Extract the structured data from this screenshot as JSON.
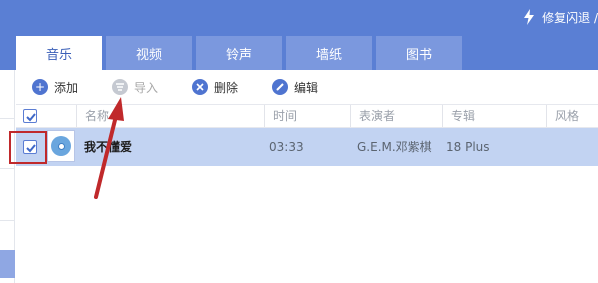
{
  "header": {
    "repair_label": "修复闪退 /"
  },
  "tabs": [
    {
      "label": "音乐",
      "active": true
    },
    {
      "label": "视频",
      "active": false
    },
    {
      "label": "铃声",
      "active": false
    },
    {
      "label": "墙纸",
      "active": false
    },
    {
      "label": "图书",
      "active": false
    }
  ],
  "toolbar": {
    "add_label": "添加",
    "import_label": "导入",
    "delete_label": "删除",
    "edit_label": "编辑",
    "add_icon": "plus-icon",
    "import_icon": "import-icon",
    "delete_icon": "x-icon",
    "edit_icon": "pencil-icon"
  },
  "table": {
    "columns": [
      "名称",
      "时间",
      "表演者",
      "专辑",
      "风格"
    ],
    "rows": [
      {
        "title": "我不懂爱",
        "time": "03:33",
        "artist": "G.E.M.邓紫棋",
        "album": "18 Plus",
        "genre": "",
        "checked": true
      }
    ]
  },
  "colors": {
    "header_blue": "#5a7fd4",
    "selected_row": "#c2d3f2",
    "highlight_red": "#c0292b"
  }
}
